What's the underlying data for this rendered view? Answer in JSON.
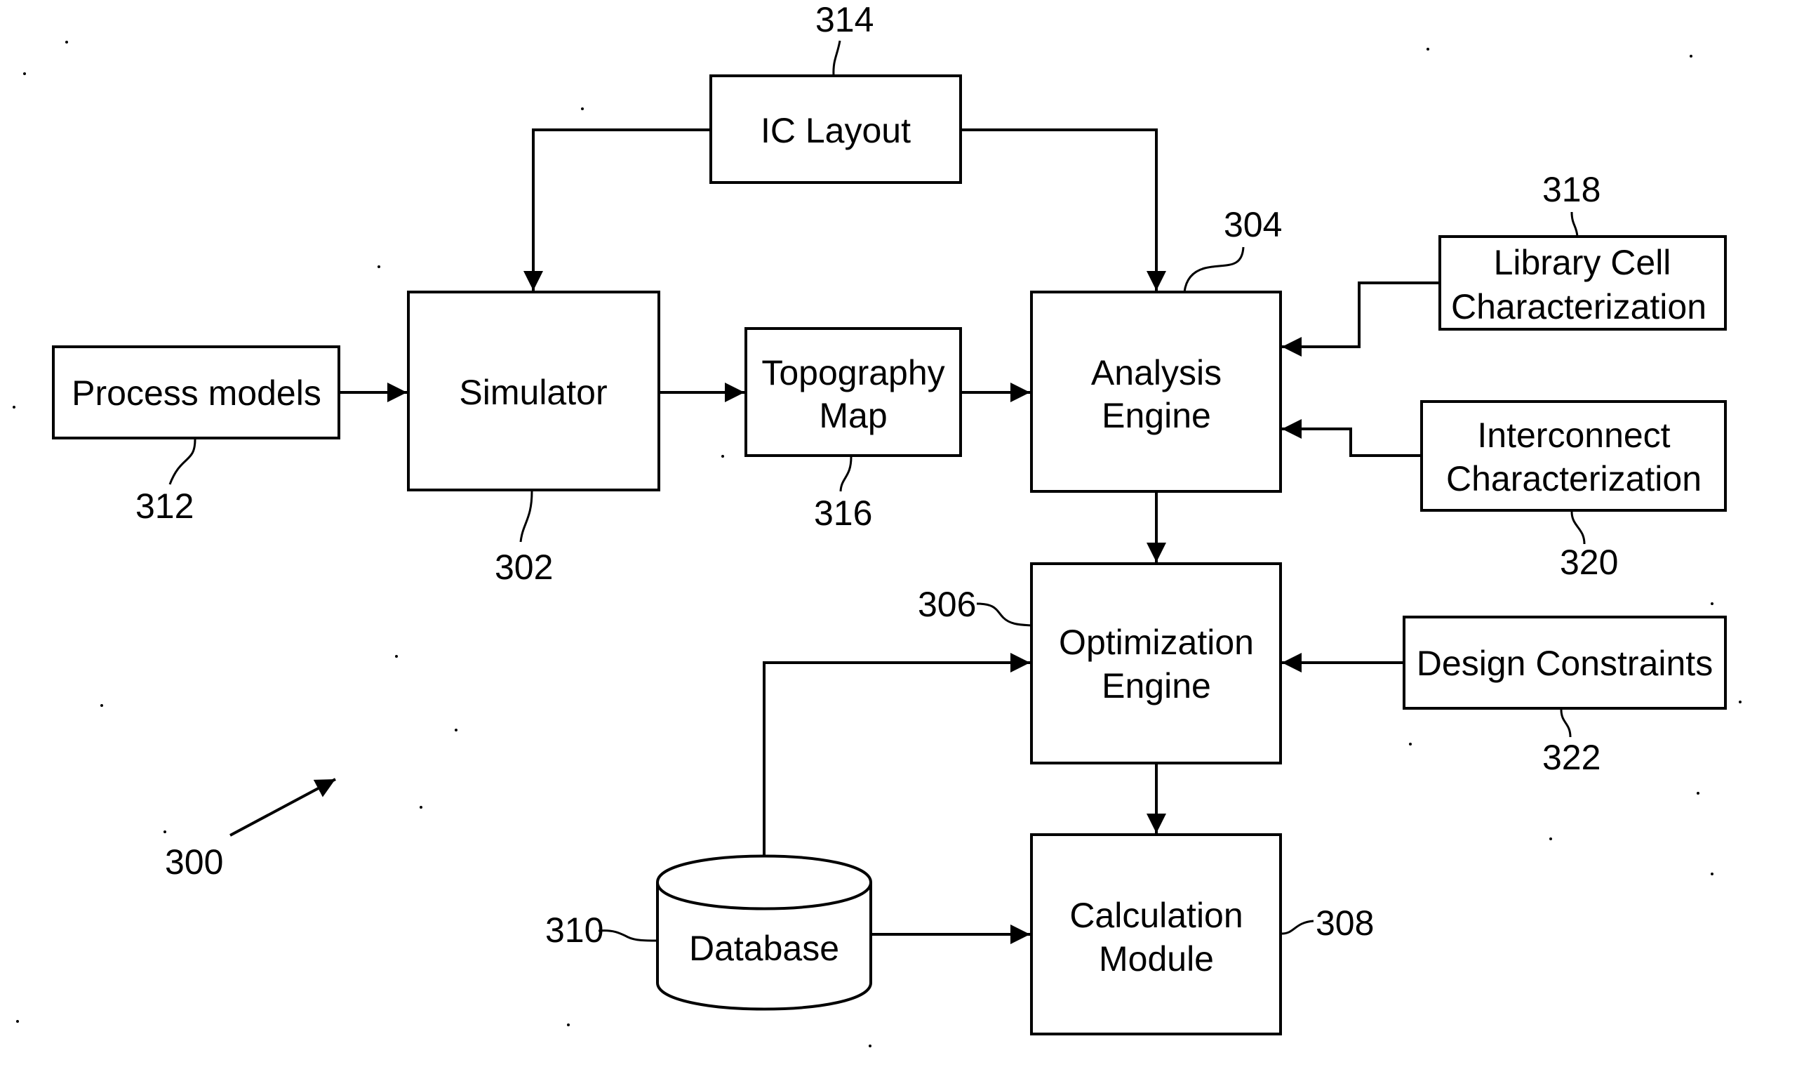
{
  "figure": {
    "reference": "300",
    "blocks": {
      "ic_layout": {
        "ref": "314",
        "lines": [
          "IC Layout"
        ]
      },
      "simulator": {
        "ref": "302",
        "lines": [
          "Simulator"
        ]
      },
      "process_models": {
        "ref": "312",
        "lines": [
          "Process models"
        ]
      },
      "topography_map": {
        "ref": "316",
        "lines": [
          "Topography",
          "Map"
        ]
      },
      "analysis_engine": {
        "ref": "304",
        "lines": [
          "Analysis",
          "Engine"
        ]
      },
      "library_cell": {
        "ref": "318",
        "lines": [
          "Library Cell",
          "Characterization"
        ]
      },
      "interconnect": {
        "ref": "320",
        "lines": [
          "Interconnect",
          "Characterization"
        ]
      },
      "optimization_engine": {
        "ref": "306",
        "lines": [
          "Optimization",
          "Engine"
        ]
      },
      "design_constraints": {
        "ref": "322",
        "lines": [
          "Design Constraints"
        ]
      },
      "calculation_module": {
        "ref": "308",
        "lines": [
          "Calculation",
          "Module"
        ]
      },
      "database": {
        "ref": "310",
        "lines": [
          "Database"
        ]
      }
    },
    "connections": [
      {
        "from": "ic_layout",
        "to": "simulator"
      },
      {
        "from": "ic_layout",
        "to": "analysis_engine"
      },
      {
        "from": "process_models",
        "to": "simulator"
      },
      {
        "from": "simulator",
        "to": "topography_map"
      },
      {
        "from": "topography_map",
        "to": "analysis_engine"
      },
      {
        "from": "library_cell",
        "to": "analysis_engine"
      },
      {
        "from": "interconnect",
        "to": "analysis_engine"
      },
      {
        "from": "analysis_engine",
        "to": "optimization_engine"
      },
      {
        "from": "design_constraints",
        "to": "optimization_engine"
      },
      {
        "from": "database",
        "to": "optimization_engine"
      },
      {
        "from": "optimization_engine",
        "to": "calculation_module"
      },
      {
        "from": "database",
        "to": "calculation_module"
      }
    ]
  }
}
